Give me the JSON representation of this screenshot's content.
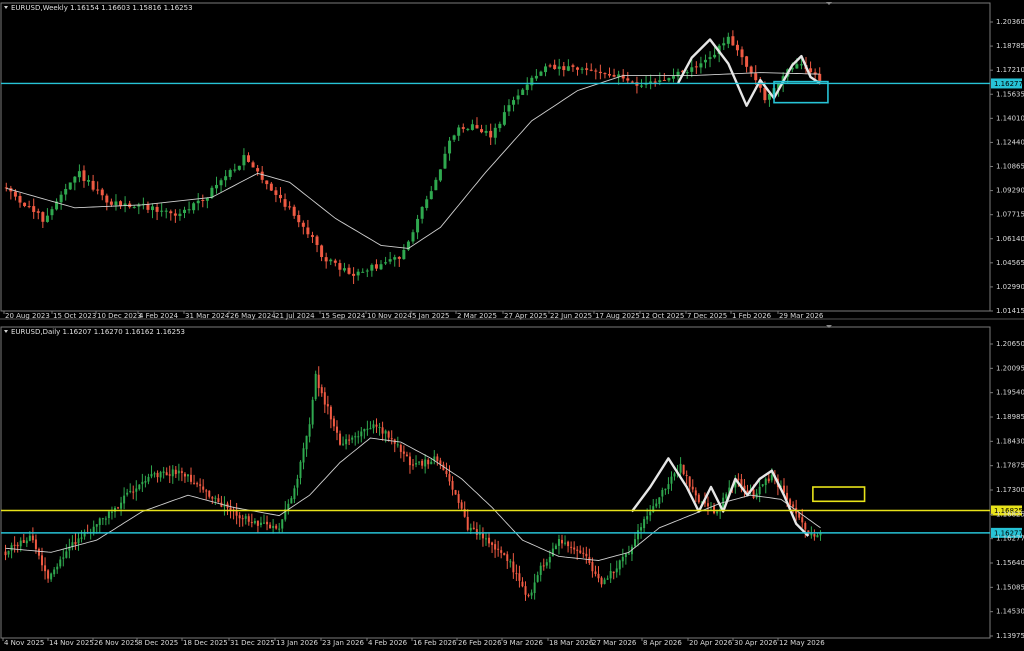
{
  "colors": {
    "background": "#000000",
    "frame": "#7a7a7a",
    "bull": "#2fa84f",
    "bear": "#ef5a43",
    "ma": "#d0d0d0",
    "pattern": "#e6e6e6",
    "cyan": "#27c3d6",
    "yellow": "#e8e31a",
    "axis_text": "#d8d8d8"
  },
  "chart_data": [
    {
      "type": "candlestick",
      "header": "EURUSD,Weekly  1.16154 1.16603 1.15816 1.16253",
      "ylim": [
        1.014,
        1.209
      ],
      "y_ticks": [
        "1.20360",
        "1.18785",
        "1.17210",
        "1.15635",
        "1.14010",
        "1.12440",
        "1.10865",
        "1.09290",
        "1.07715",
        "1.06140",
        "1.04565",
        "1.02990",
        "1.01415"
      ],
      "x_labels": [
        "20 Aug 2023",
        "15 Oct 2023",
        "10 Dec 2023",
        "4 Feb 2024",
        "31 Mar 2024",
        "26 May 2024",
        "21 Jul 2024",
        "15 Sep 2024",
        "10 Nov 2024",
        "5 Jan 2025",
        "2 Mar 2025",
        "27 Apr 2025",
        "22 Jun 2025",
        "17 Aug 2025",
        "12 Oct 2025",
        "7 Dec 2025",
        "1 Feb 2026",
        "29 Mar 2026"
      ],
      "price_label": "1.16277",
      "horizontal_lines": [
        {
          "price": 1.16277,
          "color": "cyan"
        }
      ],
      "rect_label": "cyan target box",
      "anchors": [
        [
          0,
          1.093
        ],
        [
          8,
          1.072
        ],
        [
          16,
          1.103
        ],
        [
          22,
          1.083
        ],
        [
          30,
          1.081
        ],
        [
          38,
          1.075
        ],
        [
          44,
          1.089
        ],
        [
          52,
          1.113
        ],
        [
          58,
          1.093
        ],
        [
          64,
          1.072
        ],
        [
          70,
          1.045
        ],
        [
          76,
          1.035
        ],
        [
          80,
          1.04
        ],
        [
          86,
          1.047
        ],
        [
          92,
          1.085
        ],
        [
          98,
          1.13
        ],
        [
          102,
          1.136
        ],
        [
          106,
          1.128
        ],
        [
          112,
          1.157
        ],
        [
          118,
          1.173
        ],
        [
          130,
          1.171
        ],
        [
          140,
          1.161
        ],
        [
          148,
          1.17
        ],
        [
          152,
          1.175
        ],
        [
          158,
          1.192
        ],
        [
          162,
          1.176
        ],
        [
          166,
          1.152
        ],
        [
          170,
          1.168
        ],
        [
          174,
          1.176
        ],
        [
          178,
          1.165
        ]
      ],
      "ma_anchors": [
        [
          0,
          1.093
        ],
        [
          15,
          1.08
        ],
        [
          30,
          1.082
        ],
        [
          45,
          1.087
        ],
        [
          55,
          1.103
        ],
        [
          62,
          1.097
        ],
        [
          72,
          1.073
        ],
        [
          82,
          1.055
        ],
        [
          88,
          1.053
        ],
        [
          95,
          1.067
        ],
        [
          105,
          1.104
        ],
        [
          115,
          1.138
        ],
        [
          125,
          1.158
        ],
        [
          135,
          1.168
        ],
        [
          150,
          1.168
        ],
        [
          165,
          1.17
        ],
        [
          178,
          1.169
        ]
      ],
      "pattern_points": [
        [
          147,
          1.163
        ],
        [
          150,
          1.18
        ],
        [
          154,
          1.192
        ],
        [
          158,
          1.176
        ],
        [
          162,
          1.148
        ],
        [
          165,
          1.165
        ],
        [
          168,
          1.153
        ],
        [
          172,
          1.175
        ],
        [
          174,
          1.181
        ],
        [
          176,
          1.167
        ],
        [
          178,
          1.163
        ]
      ]
    },
    {
      "type": "candlestick",
      "header": "EURUSD,Daily  1.16207 1.16270 1.16162 1.16253",
      "ylim": [
        1.138,
        1.2105
      ],
      "y_ticks": [
        "1.20650",
        "1.20095",
        "1.19540",
        "1.18985",
        "1.18430",
        "1.17875",
        "1.17300",
        "1.16825",
        "1.16277",
        "1.15640",
        "1.15085",
        "1.14530",
        "1.13975"
      ],
      "x_labels": [
        "4 Nov 2025",
        "14 Nov 2025",
        "26 Nov 2025",
        "8 Dec 2025",
        "18 Dec 2025",
        "31 Dec 2025",
        "13 Jan 2026",
        "23 Jan 2026",
        "4 Feb 2026",
        "16 Feb 2026",
        "26 Feb 2026",
        "9 Mar 2026",
        "18 Mar 2026",
        "27 Mar 2026",
        "8 Apr 2026",
        "20 Apr 2026",
        "30 Apr 2026",
        "12 May 2026"
      ],
      "price_labels": [
        "1.16825",
        "1.16277"
      ],
      "horizontal_lines": [
        {
          "price": 1.16825,
          "color": "yellow"
        },
        {
          "price": 1.16277,
          "color": "cyan"
        }
      ],
      "rect_label": "yellow target box",
      "anchors": [
        [
          0,
          1.158
        ],
        [
          8,
          1.162
        ],
        [
          14,
          1.152
        ],
        [
          22,
          1.16
        ],
        [
          35,
          1.168
        ],
        [
          45,
          1.176
        ],
        [
          58,
          1.178
        ],
        [
          70,
          1.17
        ],
        [
          82,
          1.165
        ],
        [
          90,
          1.164
        ],
        [
          96,
          1.176
        ],
        [
          100,
          1.19
        ],
        [
          102,
          1.201
        ],
        [
          106,
          1.193
        ],
        [
          110,
          1.185
        ],
        [
          116,
          1.187
        ],
        [
          122,
          1.189
        ],
        [
          128,
          1.185
        ],
        [
          134,
          1.179
        ],
        [
          142,
          1.181
        ],
        [
          146,
          1.176
        ],
        [
          152,
          1.164
        ],
        [
          160,
          1.16
        ],
        [
          166,
          1.155
        ],
        [
          172,
          1.147
        ],
        [
          176,
          1.154
        ],
        [
          182,
          1.161
        ],
        [
          190,
          1.158
        ],
        [
          196,
          1.15
        ],
        [
          204,
          1.157
        ],
        [
          210,
          1.166
        ],
        [
          216,
          1.173
        ],
        [
          222,
          1.179
        ],
        [
          228,
          1.17
        ],
        [
          234,
          1.168
        ],
        [
          240,
          1.176
        ],
        [
          246,
          1.172
        ],
        [
          252,
          1.177
        ],
        [
          258,
          1.17
        ],
        [
          264,
          1.162
        ],
        [
          268,
          1.163
        ]
      ],
      "ma_anchors": [
        [
          0,
          1.159
        ],
        [
          15,
          1.158
        ],
        [
          30,
          1.161
        ],
        [
          45,
          1.168
        ],
        [
          60,
          1.172
        ],
        [
          75,
          1.169
        ],
        [
          90,
          1.167
        ],
        [
          100,
          1.172
        ],
        [
          110,
          1.18
        ],
        [
          120,
          1.186
        ],
        [
          130,
          1.185
        ],
        [
          140,
          1.181
        ],
        [
          150,
          1.176
        ],
        [
          160,
          1.169
        ],
        [
          170,
          1.161
        ],
        [
          182,
          1.157
        ],
        [
          195,
          1.156
        ],
        [
          205,
          1.158
        ],
        [
          215,
          1.164
        ],
        [
          225,
          1.167
        ],
        [
          235,
          1.17
        ],
        [
          245,
          1.172
        ],
        [
          255,
          1.171
        ],
        [
          268,
          1.164
        ]
      ],
      "pattern_points": [
        [
          206,
          1.168
        ],
        [
          212,
          1.174
        ],
        [
          218,
          1.181
        ],
        [
          224,
          1.174
        ],
        [
          228,
          1.168
        ],
        [
          232,
          1.174
        ],
        [
          236,
          1.168
        ],
        [
          240,
          1.176
        ],
        [
          244,
          1.172
        ],
        [
          248,
          1.176
        ],
        [
          252,
          1.178
        ],
        [
          256,
          1.172
        ],
        [
          260,
          1.165
        ],
        [
          264,
          1.162
        ]
      ]
    }
  ]
}
